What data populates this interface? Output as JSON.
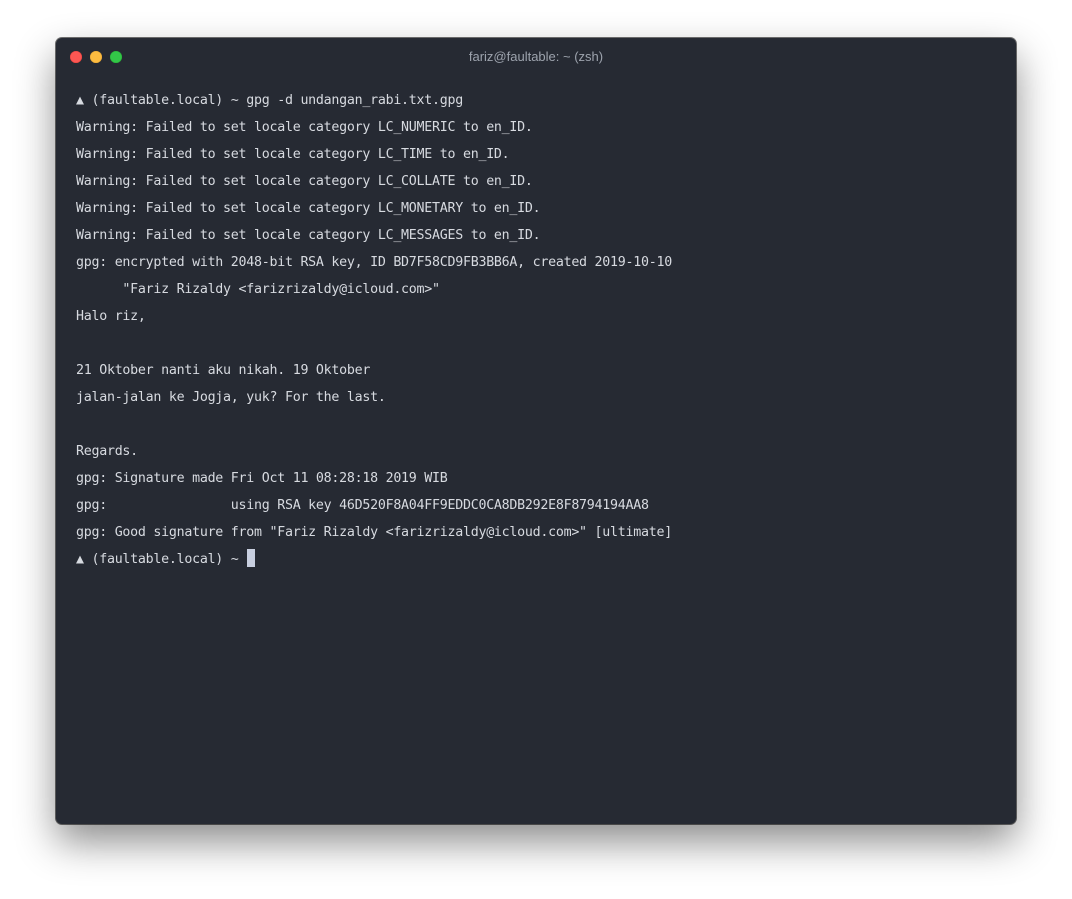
{
  "window": {
    "title": "fariz@faultable: ~ (zsh)"
  },
  "terminal": {
    "lines": [
      "▲ (faultable.local) ~ gpg -d undangan_rabi.txt.gpg",
      "Warning: Failed to set locale category LC_NUMERIC to en_ID.",
      "Warning: Failed to set locale category LC_TIME to en_ID.",
      "Warning: Failed to set locale category LC_COLLATE to en_ID.",
      "Warning: Failed to set locale category LC_MONETARY to en_ID.",
      "Warning: Failed to set locale category LC_MESSAGES to en_ID.",
      "gpg: encrypted with 2048-bit RSA key, ID BD7F58CD9FB3BB6A, created 2019-10-10",
      "      \"Fariz Rizaldy <farizrizaldy@icloud.com>\"",
      "Halo riz,",
      "",
      "21 Oktober nanti aku nikah. 19 Oktober",
      "jalan-jalan ke Jogja, yuk? For the last.",
      "",
      "Regards.",
      "gpg: Signature made Fri Oct 11 08:28:18 2019 WIB",
      "gpg:                using RSA key 46D520F8A04FF9EDDC0CA8DB292E8F8794194AA8",
      "gpg: Good signature from \"Fariz Rizaldy <farizrizaldy@icloud.com>\" [ultimate]"
    ],
    "prompt": "▲ (faultable.local) ~ "
  },
  "colors": {
    "background": "#262a33",
    "foreground": "#d7dae0",
    "cursor": "#c8cfe0",
    "close": "#fc5753",
    "minimize": "#fdbc40",
    "zoom": "#33c748"
  }
}
